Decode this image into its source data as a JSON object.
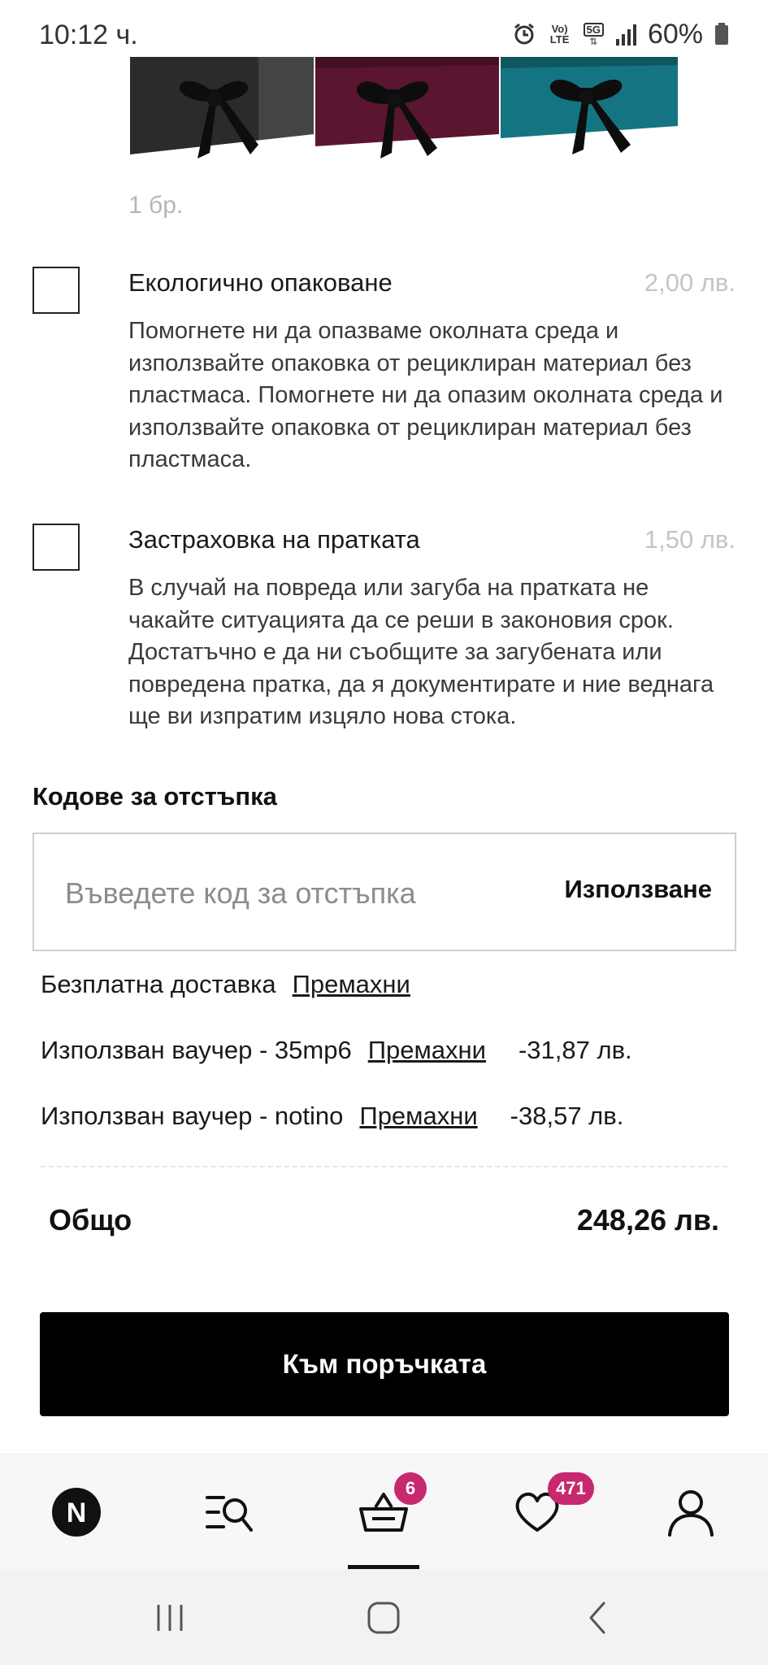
{
  "status_bar": {
    "time": "10:12 ч.",
    "battery_text": "60%",
    "volte_label": "Vo) LTE",
    "network_label": "5G",
    "icons": [
      "alarm-icon",
      "volte-icon",
      "5g-icon",
      "signal-icon",
      "battery-icon"
    ]
  },
  "gift": {
    "box_colors": [
      "#2b2b2b",
      "#5a1530",
      "#157481"
    ],
    "quantity": "1 бр."
  },
  "options": [
    {
      "title": "Екологично опаковане",
      "price": "2,00 лв.",
      "checked": false,
      "description": "Помогнете ни да опазваме околната среда и използвайте опаковка от рециклиран материал без пластмаса. Помогнете ни да опазим околната среда и използвайте опаковка от рециклиран материал без пластмаса."
    },
    {
      "title": "Застраховка на пратката",
      "price": "1,50 лв.",
      "checked": false,
      "description": "В случай на повреда или загуба на пратката не чакайте ситуацията да се реши в законовия срок. Достатъчно е да ни съобщите за загубената или повредена пратка, да я документирате и ние веднага ще ви изпратим изцяло нова стока."
    }
  ],
  "discount": {
    "section_title": "Кодове за отстъпка",
    "input_value": "",
    "placeholder": "Въведете код за отстъпка",
    "apply_label": "Използване"
  },
  "applied": [
    {
      "label": "Безплатна доставка",
      "remove_label": "Премахни",
      "amount": ""
    },
    {
      "label": "Използван ваучер - 35mp6",
      "remove_label": "Премахни",
      "amount": "-31,87 лв."
    },
    {
      "label": "Използван ваучер - notino",
      "remove_label": "Премахни",
      "amount": "-38,57 лв."
    }
  ],
  "total": {
    "label": "Общо",
    "value": "248,26 лв."
  },
  "checkout_label": "Към поръчката",
  "bottom_nav": {
    "items": [
      {
        "name": "home",
        "icon": "notino-logo-icon"
      },
      {
        "name": "categories",
        "icon": "menu-search-icon"
      },
      {
        "name": "cart",
        "icon": "basket-icon",
        "badge": "6",
        "active": true
      },
      {
        "name": "favorites",
        "icon": "heart-icon",
        "badge": "471"
      },
      {
        "name": "profile",
        "icon": "user-icon"
      }
    ],
    "badge_color": "#c8286e",
    "logo_letter": "N"
  },
  "system_nav": [
    "recents-icon",
    "home-icon",
    "back-icon"
  ]
}
